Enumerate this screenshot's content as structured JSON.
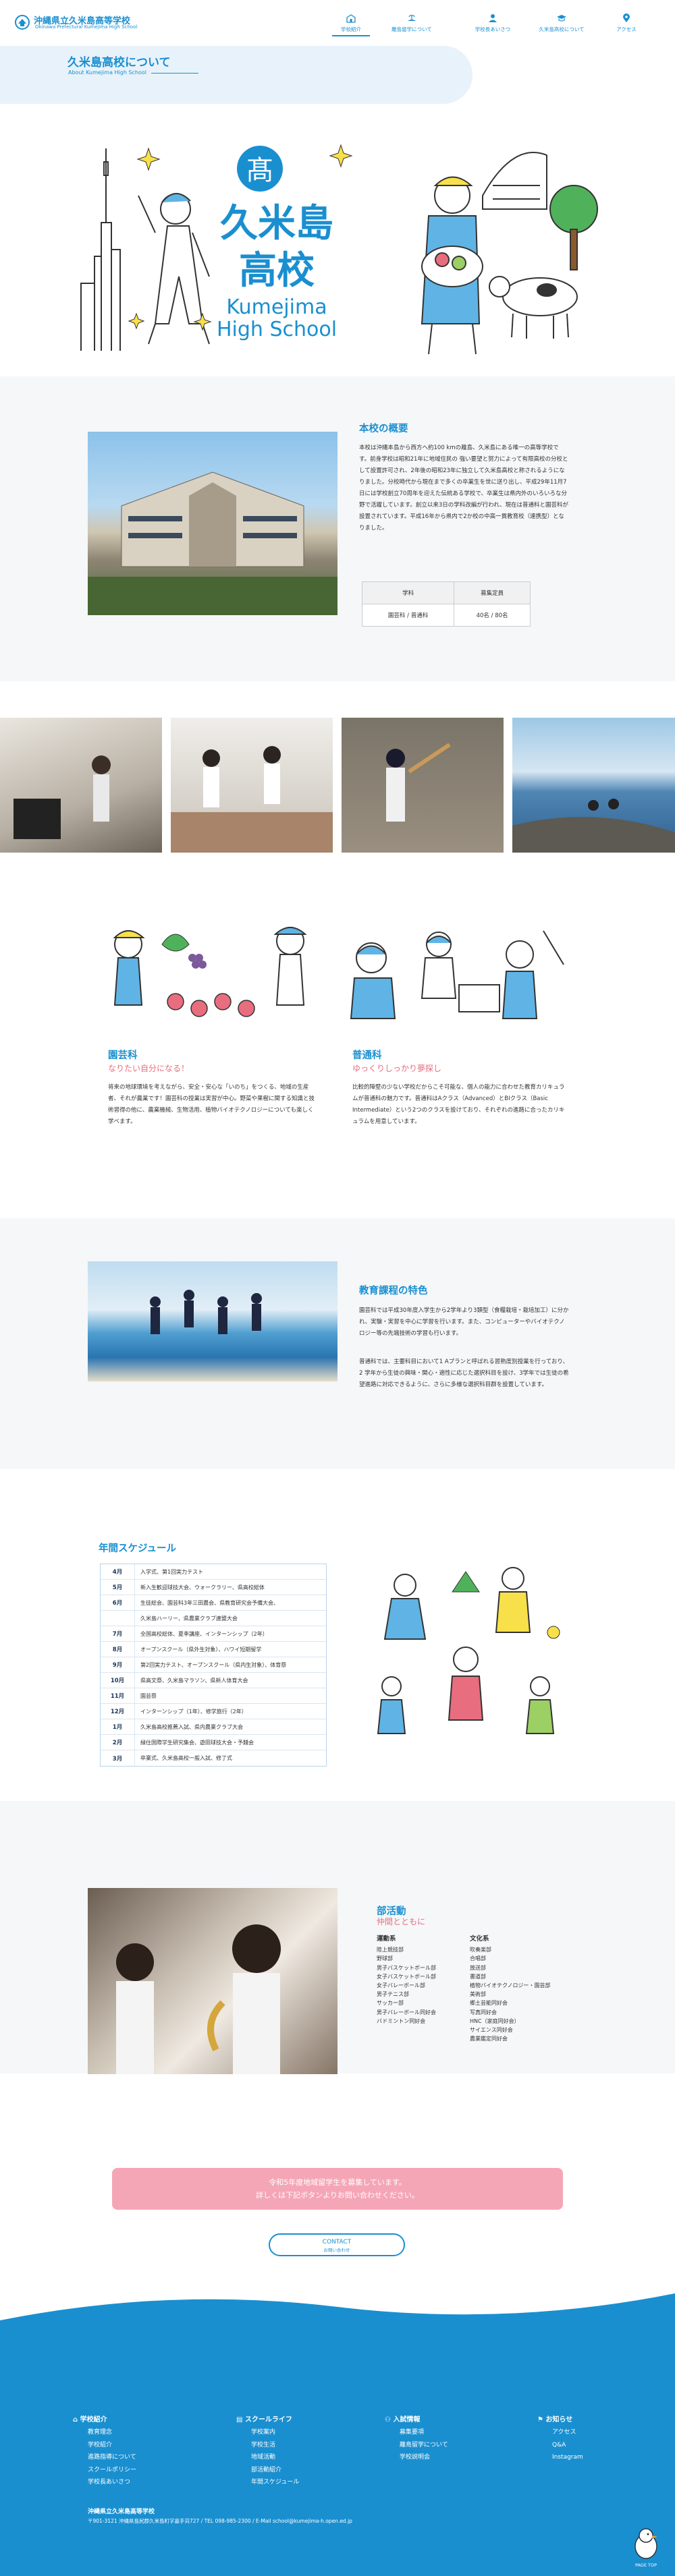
{
  "header": {
    "logo_title": "沖縄県立久米島高等学校",
    "logo_sub": "Okinawa Prefectural Kumejima High School",
    "nav": [
      {
        "label": "学校紹介",
        "icon": "school-icon"
      },
      {
        "label": "離島留学について",
        "icon": "island-icon"
      },
      {
        "label": "学校長あいさつ",
        "icon": "person-icon"
      },
      {
        "label": "久米島高校について",
        "icon": "graduation-cap-icon"
      },
      {
        "label": "アクセス",
        "icon": "map-pin-icon"
      }
    ]
  },
  "page_title": {
    "jp": "久米島高校について",
    "en": "About Kumejima High School"
  },
  "hero": {
    "kanji_badge": "髙",
    "school_name_jp_1": "久米島",
    "school_name_jp_2": "高校",
    "school_name_en_1": "Kumejima",
    "school_name_en_2": "High School"
  },
  "overview": {
    "heading": "本校の概要",
    "text": "本校は沖縄本島から西方へ約100 kmの離島、久米島にある唯一の高等学校です。前身学校は昭和21年に地域住民の 強い要望と努力によって有限高校の分校として設置許可され、2年後の昭和23年に独立して久米島高校と称されるようになりました。分校時代から現在まで多くの卒業生を世に送り出し、平成29年11月7日には学校創立70周年を迎えた伝統ある学校で、卒業生は県内外のいろいろな分野で活躍しています。創立以来3日の学科改編が行われ、現在は普通科と園芸科が設置されています。平成16年から県内で2か校の中高一貫教育校（連携型）となりました。",
    "table_headers": [
      "学科",
      "募集定員"
    ],
    "table_rows": [
      [
        "園芸科 / 普通科",
        "40名 / 80名"
      ]
    ]
  },
  "courses": {
    "horti": {
      "title": "園芸科",
      "sub": "なりたい自分になる！",
      "text": "将来の地球環境を考えながら、安全・安心な「いのち」をつくる、地域の生産者、それが農業です！園芸科の授業は実習が中心。野菜や果樹に関する知識と技術習得の他に、農業機械、生物活用、植物バイオテクノロジーについても楽しく学べます。"
    },
    "general": {
      "title": "普通科",
      "sub": "ゆっくりしっかり夢探し",
      "text": "比較的障壁の少ない学校だからこそ可能な、個人の能力に合わせた教育カリキュラムが普通科の魅力です。普通科はAクラス（Advanced）とBIクラス（Basic Intermediate）という2つのクラスを設けており、それぞれの進路に合ったカリキュラムを用意しています。"
    }
  },
  "features": {
    "heading": "教育課程の特色",
    "p1": "園芸科では平成30年度入学生から2学年より3類型（食糧栽培・栽培加工）に分かれ、実験・実習を中心に学習を行います。また、コンピューターやバイオテクノロジー等の先端技術の学習も行います。",
    "p2": "普通科では、主要科目において1 Aプランと呼ばれる習熟度別授業を行っており、2 学年から生徒の興味・関心・適性に応じた選択科目を設け、3学年では生徒の希望進路に対応できるように、さらに多様な選択科目群を設置しています。"
  },
  "schedule": {
    "heading": "年間スケジュール",
    "rows": [
      {
        "m": "4月",
        "e": "入学式、第1回実力テスト"
      },
      {
        "m": "5月",
        "e": "新入生歓迎球技大会、ウォークラリー、県高校総体"
      },
      {
        "m": "6月",
        "e": "生徒総会、園芸科3年三田農会、県教育研究会予備大会、"
      },
      {
        "m": "",
        "e": "久米島ハーリー、県農業クラブ連盟大会"
      },
      {
        "m": "7月",
        "e": "全国高校総体、夏季講座、インターンシップ（2年）"
      },
      {
        "m": "8月",
        "e": "オープンスクール（県外生対象）、ハワイ短期留学"
      },
      {
        "m": "9月",
        "e": "第2回実力テスト、オープンスクール（県内生対象）、体育祭"
      },
      {
        "m": "10月",
        "e": "県高文祭、久米島マラソン、県新人体育大会"
      },
      {
        "m": "11月",
        "e": "園芸祭"
      },
      {
        "m": "12月",
        "e": "インターンシップ（1年）、修学旅行（2年）"
      },
      {
        "m": "1月",
        "e": "久米島高校推薦入試、県内農業クラブ大会"
      },
      {
        "m": "2月",
        "e": "緑住国際学生研究集会、遊田球技大会・予餞会"
      },
      {
        "m": "3月",
        "e": "卒業式、久米島高校一般入試、修了式"
      }
    ]
  },
  "clubs": {
    "heading": "部活動",
    "sub": "仲間とともに",
    "sports_heading": "運動系",
    "sports": [
      "陸上競技部",
      "野球部",
      "男子バスケットボール部",
      "女子バスケットボール部",
      "女子バレーボール部",
      "男子テニス部",
      "サッカー部",
      "男子バレーボール同好会",
      "バドミントン同好会"
    ],
    "culture_heading": "文化系",
    "culture": [
      "吹奏楽部",
      "合唱部",
      "放送部",
      "書道部",
      "植物バイオテクノロジー・園芸部",
      "美術部",
      "郷土芸能同好会",
      "写真同好会",
      "HNC（家庭同好会）",
      "サイエンス同好会",
      "農業鑑定同好会"
    ]
  },
  "recruit": {
    "line1": "令和5年度地域留学生を募集しています。",
    "line2": "詳しくは下記ボタンよりお問い合わせください。",
    "contact_label": "CONTACT",
    "contact_sub": "お問い合わせ"
  },
  "footer": {
    "cols": [
      {
        "heading": "学校紹介",
        "icon": "school-icon",
        "links": [
          "教育理念",
          "学校紹介",
          "進路指導について",
          "スクールポリシー",
          "学校長あいさつ"
        ]
      },
      {
        "heading": "スクールライフ",
        "icon": "book-icon",
        "links": [
          "学校案内",
          "学校生活",
          "地域活動",
          "部活動紹介",
          "年間スケジュール"
        ]
      },
      {
        "heading": "入試情報",
        "icon": "person-icon",
        "links": [
          "募集要項",
          "離島留学について",
          "学校説明会"
        ]
      },
      {
        "heading": "お知らせ",
        "icon": "flag-icon",
        "links": [
          "アクセス",
          "Q&A",
          "Instagram"
        ]
      }
    ],
    "school": "沖縄県立久米島高等学校",
    "address": "〒901-3121 沖縄県島尻郡久米島町字嘉手苅727 / TEL 098-985-2300 / E-Mail school@kumejima-h.open.ed.jp",
    "page_top": "PAGE TOP"
  },
  "colors": {
    "accent": "#1a8fd0",
    "pink": "#e86d7e",
    "light": "#e8f2fb"
  }
}
